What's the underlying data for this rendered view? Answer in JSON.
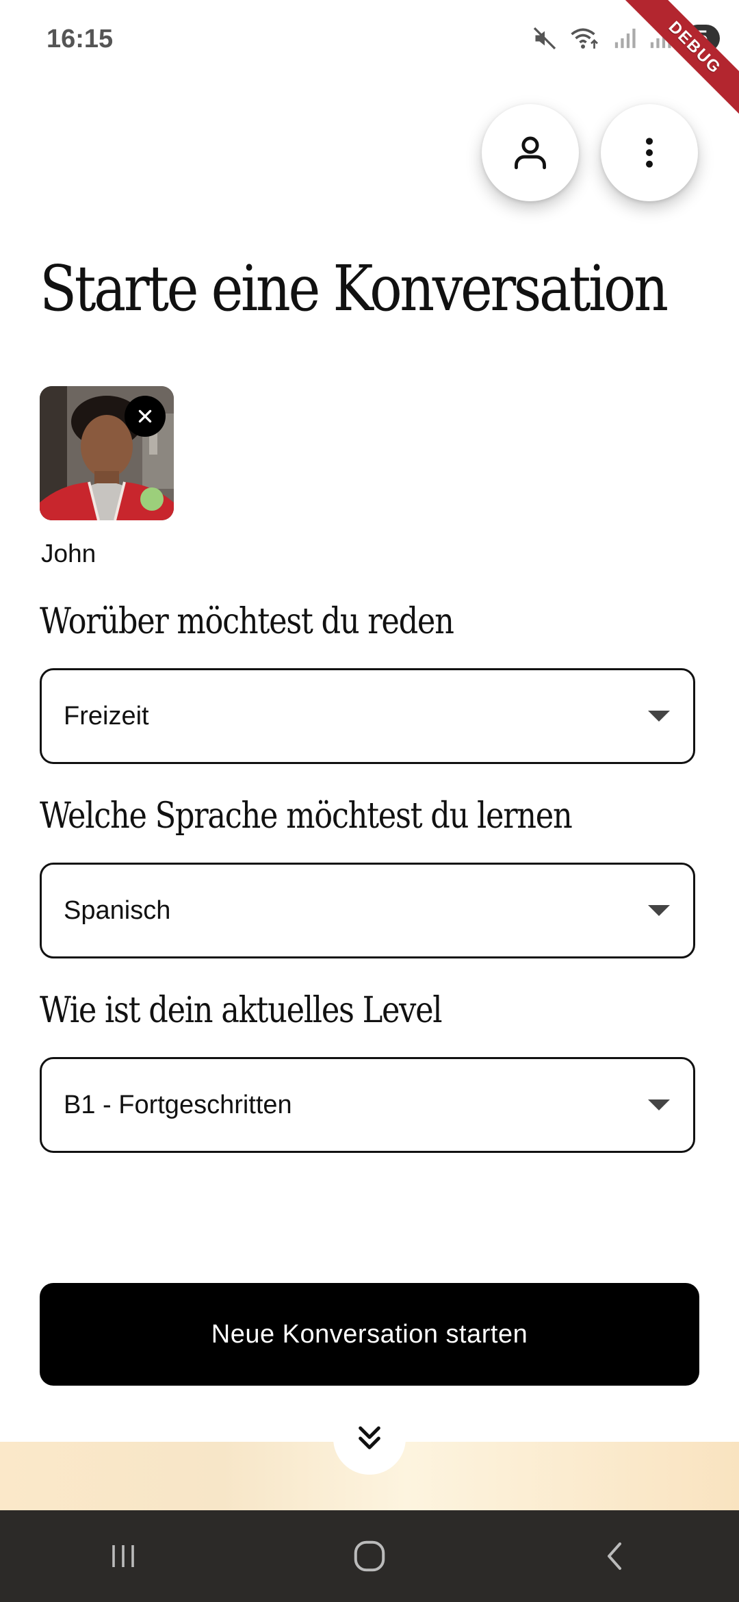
{
  "status_bar": {
    "time": "16:15",
    "icons": [
      "mute-icon",
      "wifi-icon",
      "signal-icon",
      "signal-icon"
    ],
    "battery": "5"
  },
  "debug_banner": "DEBUG",
  "header": {
    "profile_icon": "person-icon",
    "menu_icon": "more-vertical-icon"
  },
  "page": {
    "title": "Starte eine Konversation"
  },
  "partner": {
    "name": "John",
    "online_color": "#9ccf7b"
  },
  "form": {
    "topic": {
      "question": "Worüber möchtest du reden",
      "value": "Freizeit"
    },
    "language": {
      "question": "Welche Sprache möchtest du lernen",
      "value": "Spanisch"
    },
    "level": {
      "question": "Wie ist dein aktuelles Level",
      "value": "B1 - Fortgeschritten"
    }
  },
  "actions": {
    "start_label": "Neue Konversation starten",
    "scroll_icon": "double-chevron-down-icon"
  },
  "nav": {
    "recents_icon": "recents-icon",
    "home_icon": "home-icon",
    "back_icon": "back-icon"
  }
}
